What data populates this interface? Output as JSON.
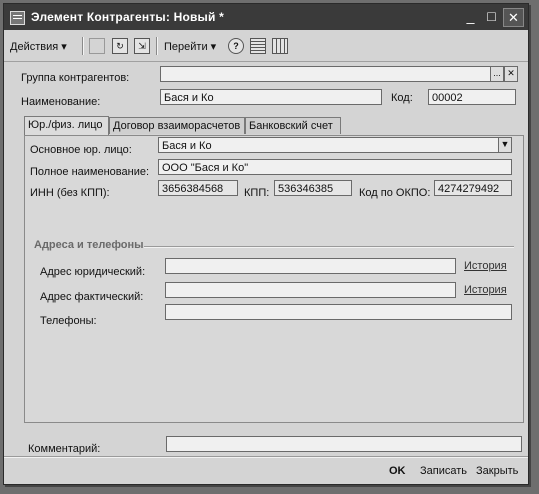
{
  "window": {
    "title": "Элемент Контрагенты: Новый *",
    "controls": {
      "minimize": "_",
      "maximize": "□",
      "close": "✕"
    }
  },
  "toolbar": {
    "actions_label": "Действия",
    "goto_label": "Перейти",
    "help_label": "?"
  },
  "form": {
    "group_label": "Группа контрагентов:",
    "group_value": "",
    "group_select": "...",
    "group_clear": "✕",
    "name_label": "Наименование:",
    "name_value": "Бася и Ко",
    "code_label": "Код:",
    "code_value": "00002"
  },
  "tabs": [
    {
      "label": "Юр./физ. лицо"
    },
    {
      "label": "Договор взаиморасчетов"
    },
    {
      "label": "Банковский счет"
    }
  ],
  "legal": {
    "type_label": "Основное юр. лицо:",
    "type_value": "Бася и Ко",
    "full_name_label": "Полное наименование:",
    "full_name_value": "ООО \"Бася и Ко\"",
    "inn_label": "ИНН (без КПП):",
    "inn_value": "3656384568",
    "kpp_label": "КПП:",
    "kpp_value": "536346385",
    "okpo_label": "Код по ОКПО:",
    "okpo_value": "4274279492"
  },
  "address": {
    "section_title": "Адреса и телефоны",
    "legal_address_label": "Адрес юридический:",
    "legal_address_value": "",
    "actual_address_label": "Адрес фактический:",
    "actual_address_value": "",
    "phones_label": "Телефоны:",
    "phones_value": "",
    "history_link": "История"
  },
  "comment": {
    "label": "Комментарий:",
    "value": ""
  },
  "footer": {
    "ok_label": "OK",
    "save_label": "Записать",
    "close_label": "Закрыть"
  }
}
